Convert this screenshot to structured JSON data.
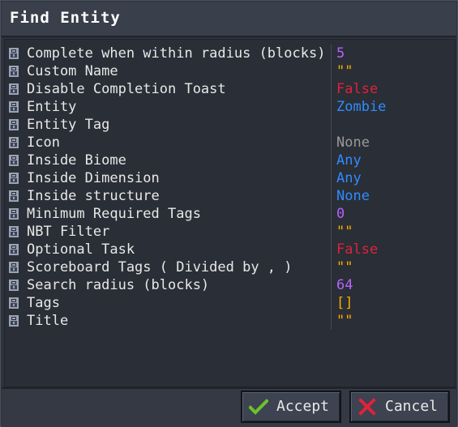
{
  "window": {
    "title": "Find Entity"
  },
  "properties": [
    {
      "label": "Complete when within radius (blocks)",
      "value": "5",
      "color": "#b463ff"
    },
    {
      "label": "Custom Name",
      "value": "\"\"",
      "color": "#ffaa00"
    },
    {
      "label": "Disable Completion Toast",
      "value": "False",
      "color": "#e0223a"
    },
    {
      "label": "Entity",
      "value": "Zombie",
      "color": "#2f8cff"
    },
    {
      "label": "Entity Tag",
      "value": "",
      "color": "#e8e8e8"
    },
    {
      "label": "Icon",
      "value": "None",
      "color": "#9a9a9a"
    },
    {
      "label": "Inside Biome",
      "value": "Any",
      "color": "#2f8cff"
    },
    {
      "label": "Inside Dimension",
      "value": "Any",
      "color": "#2f8cff"
    },
    {
      "label": "Inside structure",
      "value": "None",
      "color": "#2f8cff"
    },
    {
      "label": "Minimum Required Tags",
      "value": "0",
      "color": "#b463ff"
    },
    {
      "label": "NBT Filter",
      "value": "\"\"",
      "color": "#ffaa00"
    },
    {
      "label": "Optional Task",
      "value": "False",
      "color": "#e0223a"
    },
    {
      "label": "Scoreboard Tags ( Divided by , )",
      "value": "\"\"",
      "color": "#ffaa00"
    },
    {
      "label": "Search radius (blocks)",
      "value": "64",
      "color": "#b463ff"
    },
    {
      "label": "Tags",
      "value": "[]",
      "color": "#ffaa00"
    },
    {
      "label": "Title",
      "value": "\"\"",
      "color": "#ffaa00"
    }
  ],
  "footer": {
    "accept_label": "Accept",
    "cancel_label": "Cancel"
  },
  "icons": {
    "row_icon": "lock-icon",
    "accept_icon": "checkmark-icon",
    "cancel_icon": "x-mark-icon"
  },
  "colors": {
    "accept": "#6ec12a",
    "cancel": "#e0223a"
  }
}
